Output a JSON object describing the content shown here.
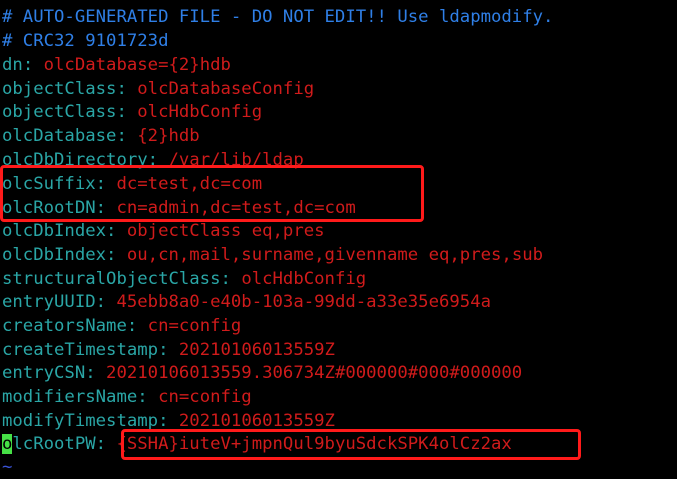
{
  "comments": [
    "# AUTO-GENERATED FILE - DO NOT EDIT!! Use ldapmodify.",
    "# CRC32 9101723d"
  ],
  "entries": [
    {
      "key": "dn",
      "value": "olcDatabase={2}hdb"
    },
    {
      "key": "objectClass",
      "value": "olcDatabaseConfig"
    },
    {
      "key": "objectClass",
      "value": "olcHdbConfig"
    },
    {
      "key": "olcDatabase",
      "value": "{2}hdb"
    },
    {
      "key": "olcDbDirectory",
      "value": "/var/lib/ldap"
    },
    {
      "key": "olcSuffix",
      "value": "dc=test,dc=com"
    },
    {
      "key": "olcRootDN",
      "value": "cn=admin,dc=test,dc=com"
    },
    {
      "key": "olcDbIndex",
      "value": "objectClass eq,pres"
    },
    {
      "key": "olcDbIndex",
      "value": "ou,cn,mail,surname,givenname eq,pres,sub"
    },
    {
      "key": "structuralObjectClass",
      "value": "olcHdbConfig"
    },
    {
      "key": "entryUUID",
      "value": "45ebb8a0-e40b-103a-99dd-a33e35e6954a"
    },
    {
      "key": "creatorsName",
      "value": "cn=config"
    },
    {
      "key": "createTimestamp",
      "value": "20210106013559Z"
    },
    {
      "key": "entryCSN",
      "value": "20210106013559.306734Z#000000#000#000000"
    },
    {
      "key": "modifiersName",
      "value": "cn=config"
    },
    {
      "key": "modifyTimestamp",
      "value": "20210106013559Z"
    },
    {
      "key_cursor_char": "o",
      "key_rest": "lcRootPW",
      "value": "{SSHA}iuteV+jmpnQul9byuSdckSPK4olCz2ax"
    }
  ],
  "tilde": "~",
  "colon": ": ",
  "colors": {
    "comment": "#2f7fe6",
    "key": "#2aa6a6",
    "value": "#d01b1b",
    "cursor": "#46e046",
    "highlight": "#ff1a1a",
    "background": "#000000"
  }
}
